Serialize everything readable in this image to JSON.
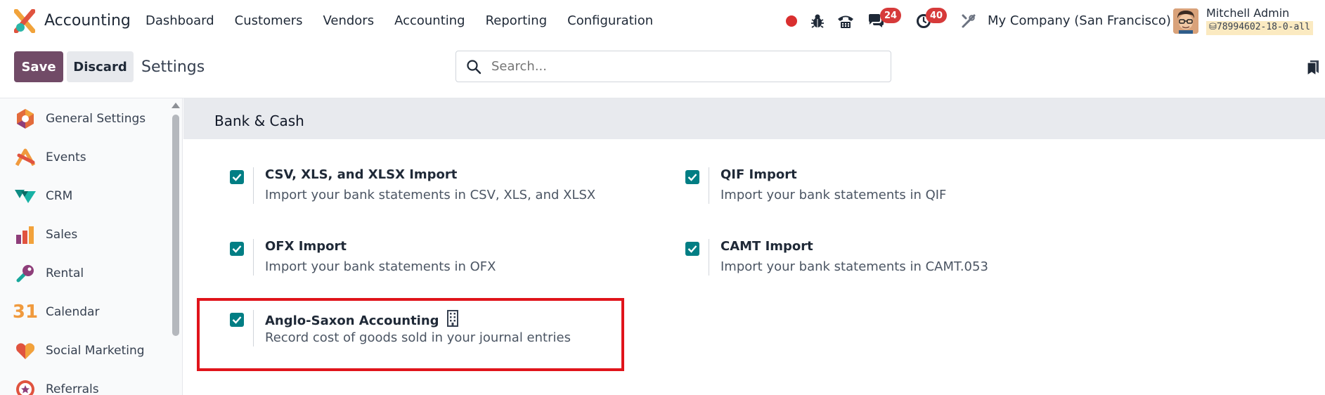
{
  "topbar": {
    "app_title": "Accounting",
    "menu": [
      "Dashboard",
      "Customers",
      "Vendors",
      "Accounting",
      "Reporting",
      "Configuration"
    ],
    "messages_badge": "24",
    "activities_badge": "40",
    "company": "My Company (San Francisco)",
    "user_name": "Mitchell Admin",
    "database": "78994602-18-0-all"
  },
  "control": {
    "save_label": "Save",
    "discard_label": "Discard",
    "breadcrumb": "Settings",
    "search_placeholder": "Search..."
  },
  "sidebar": {
    "items": [
      {
        "label": "General Settings",
        "icon": "general-settings-icon"
      },
      {
        "label": "Events",
        "icon": "events-icon"
      },
      {
        "label": "CRM",
        "icon": "crm-icon"
      },
      {
        "label": "Sales",
        "icon": "sales-icon"
      },
      {
        "label": "Rental",
        "icon": "rental-icon"
      },
      {
        "label": "Calendar",
        "icon": "calendar-icon"
      },
      {
        "label": "Social Marketing",
        "icon": "social-marketing-icon"
      },
      {
        "label": "Referrals",
        "icon": "referrals-icon"
      }
    ],
    "calendar_icon_text": "31"
  },
  "section": {
    "title": "Bank & Cash",
    "settings": [
      {
        "title": "CSV, XLS, and XLSX Import",
        "description": "Import your bank statements in CSV, XLS, and XLSX",
        "checked": true
      },
      {
        "title": "QIF Import",
        "description": "Import your bank statements in QIF",
        "checked": true
      },
      {
        "title": "OFX Import",
        "description": "Import your bank statements in OFX",
        "checked": true
      },
      {
        "title": "CAMT Import",
        "description": "Import your bank statements in CAMT.053",
        "checked": true
      },
      {
        "title": "Anglo-Saxon Accounting",
        "description": "Record cost of goods sold in your journal entries",
        "checked": true
      }
    ]
  },
  "colors": {
    "brand": "#714b67",
    "checkbox": "#017e84",
    "badge": "#d63a3a",
    "highlight": "#e0141b"
  }
}
